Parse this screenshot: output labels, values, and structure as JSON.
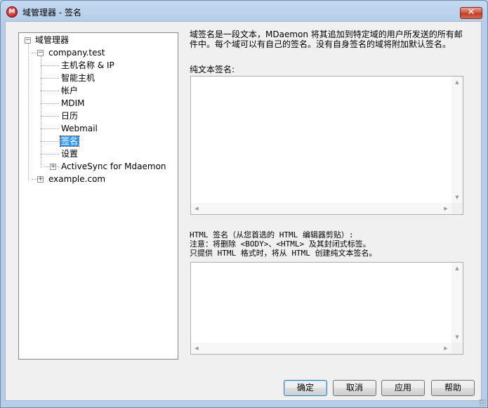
{
  "window": {
    "title": "域管理器 - 签名",
    "app_icon_letter": "M",
    "close_glyph": "✕"
  },
  "tree": {
    "root": "域管理器",
    "domain1": "company.test",
    "children": [
      "主机名称 & IP",
      "智能主机",
      "帐户",
      "MDIM",
      "日历",
      "Webmail",
      "签名",
      "设置",
      "ActiveSync for Mdaemon"
    ],
    "selected": "签名",
    "domain2": "example.com",
    "expand_plus": "+",
    "expand_minus": "−"
  },
  "main": {
    "description": "域签名是一段文本，MDaemon 将其追加到特定域的用户所发送的所有邮件中。每个域可以有自己的签名。没有自身签名的域将附加默认签名。",
    "plain_label": "纯文本签名:",
    "plain_value": "",
    "html_label_line1": "HTML 签名（从您首选的 HTML 编辑器剪贴）:",
    "html_label_line2": "注意：将删除 <BODY>、<HTML> 及其封闭式标签。",
    "html_label_line3": "只提供 HTML 格式时，将从 HTML 创建纯文本签名。",
    "html_value": ""
  },
  "buttons": {
    "ok": "确定",
    "cancel": "取消",
    "apply": "应用",
    "help": "帮助"
  },
  "icons": {
    "up": "▲",
    "down": "▼",
    "left": "◀",
    "right": "▶"
  }
}
